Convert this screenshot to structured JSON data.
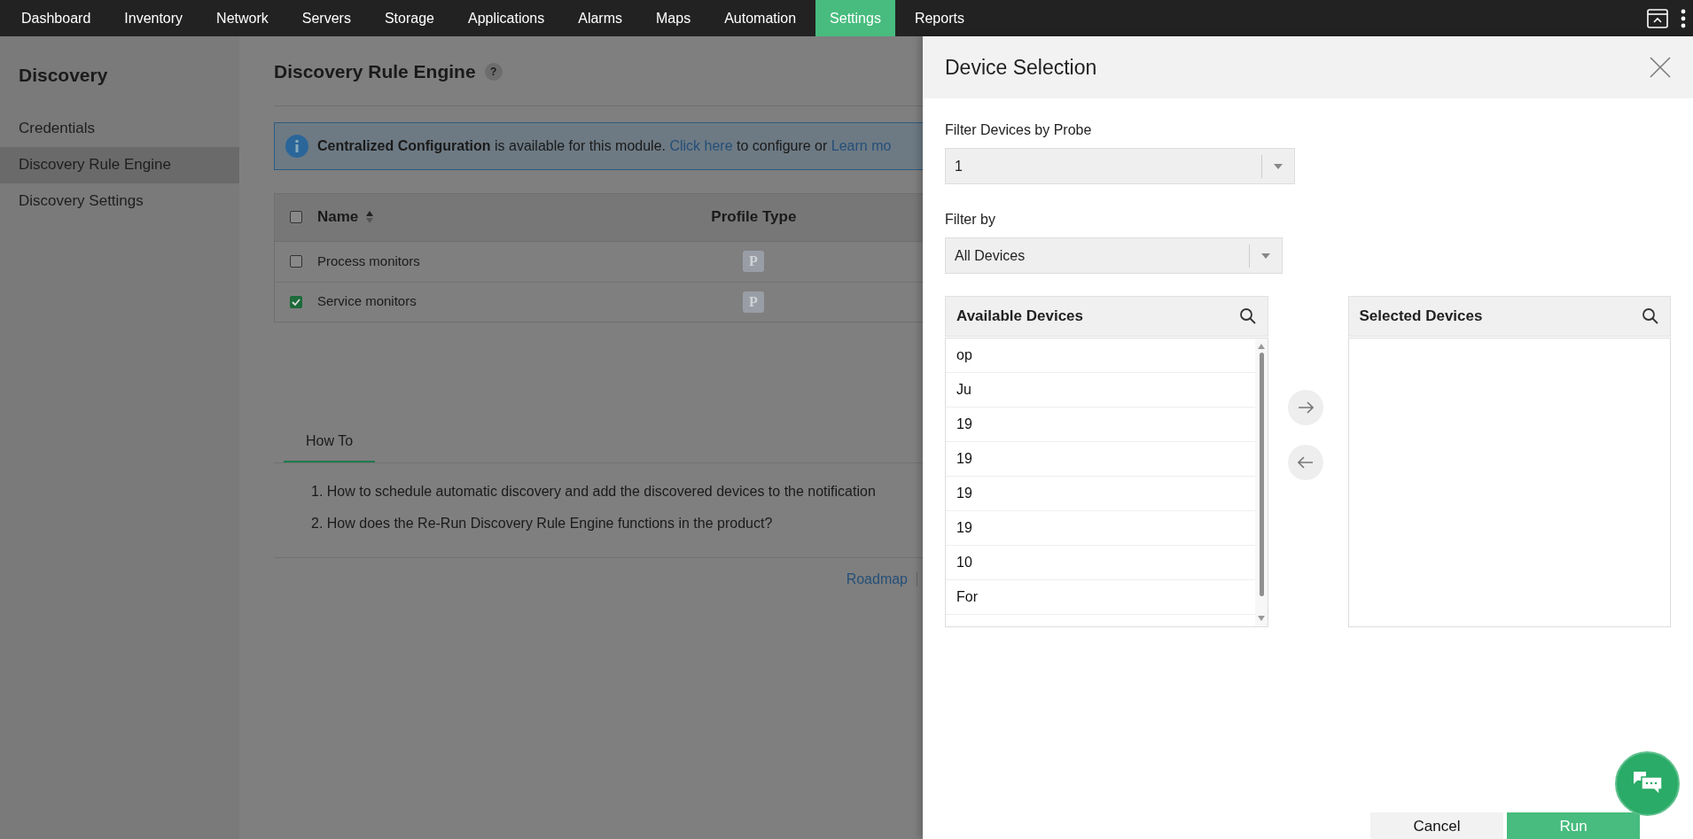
{
  "nav": {
    "tabs": [
      {
        "label": "Dashboard",
        "selected": false
      },
      {
        "label": "Inventory",
        "selected": false
      },
      {
        "label": "Network",
        "selected": false
      },
      {
        "label": "Servers",
        "selected": false
      },
      {
        "label": "Storage",
        "selected": false
      },
      {
        "label": "Applications",
        "selected": false
      },
      {
        "label": "Alarms",
        "selected": false
      },
      {
        "label": "Maps",
        "selected": false
      },
      {
        "label": "Automation",
        "selected": false
      },
      {
        "label": "Settings",
        "selected": true
      },
      {
        "label": "Reports",
        "selected": false
      }
    ]
  },
  "sidebar": {
    "title": "Discovery",
    "items": [
      {
        "label": "Credentials",
        "selected": false
      },
      {
        "label": "Discovery Rule Engine",
        "selected": true
      },
      {
        "label": "Discovery Settings",
        "selected": false
      }
    ]
  },
  "main": {
    "title": "Discovery Rule Engine",
    "help": "?",
    "banner": {
      "bold": "Centralized Configuration",
      "text": "is available for this module.",
      "link": "Click here",
      "text2": "to configure or",
      "link2": "Learn mo"
    },
    "table": {
      "select_all_checked": false,
      "columns": [
        "Name",
        "Profile Type"
      ],
      "rows": [
        {
          "name": "Process monitors",
          "badge": "P",
          "checked": false
        },
        {
          "name": "Service monitors",
          "badge": "P",
          "checked": true
        }
      ]
    },
    "howto": {
      "tab": "How To",
      "items": [
        "1. How to schedule automatic discovery and add the discovered devices to the notification",
        "2. How does the Re-Run Discovery Rule Engine functions in the product?"
      ]
    },
    "footer_links": [
      "Roadmap"
    ]
  },
  "drawer": {
    "title": "Device Selection",
    "probe_label": "Filter Devices by Probe",
    "probe_value": "1",
    "filter_label": "Filter by",
    "filter_value": "All Devices",
    "available": {
      "title": "Available Devices",
      "items": [
        "op",
        "Ju",
        "19",
        "19",
        "19",
        "19",
        "10",
        "For"
      ]
    },
    "selected": {
      "title": "Selected Devices"
    },
    "buttons": [
      "Cancel",
      "Run"
    ]
  }
}
